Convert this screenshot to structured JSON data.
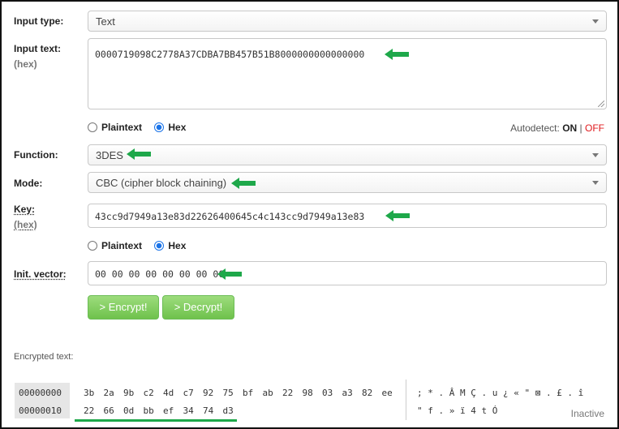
{
  "input_type": {
    "label": "Input type:",
    "value": "Text"
  },
  "input_text": {
    "label": "Input text:",
    "sub": "(hex)",
    "value": "0000719098C2778A37CDBA7BB457B51B8000000000000000"
  },
  "input_format": {
    "plaintext": "Plaintext",
    "hex": "Hex",
    "selected": "Hex"
  },
  "autodetect": {
    "label": "Autodetect:",
    "on": "ON",
    "sep": "|",
    "off": "OFF"
  },
  "function": {
    "label": "Function:",
    "value": "3DES"
  },
  "mode": {
    "label": "Mode:",
    "value": "CBC (cipher block chaining)"
  },
  "key": {
    "label": "Key:",
    "sub": "(hex)",
    "value": "43cc9d7949a13e83d22626400645c4c143cc9d7949a13e83"
  },
  "key_format": {
    "plaintext": "Plaintext",
    "hex": "Hex",
    "selected": "Hex"
  },
  "iv": {
    "label": "Init. vector:",
    "value": "00 00 00 00 00 00 00 00"
  },
  "buttons": {
    "encrypt": "> Encrypt!",
    "decrypt": "> Decrypt!"
  },
  "output": {
    "label": "Encrypted text:",
    "rows": [
      {
        "offset": "00000000",
        "bytes": [
          "3b",
          "2a",
          "9b",
          "c2",
          "4d",
          "c7",
          "92",
          "75",
          "bf",
          "ab",
          "22",
          "98",
          "03",
          "a3",
          "82",
          "ee"
        ],
        "ascii": "; * . Â M Ç . u ¿ « \" ⊠ . £ . î"
      },
      {
        "offset": "00000010",
        "bytes": [
          "22",
          "66",
          "0d",
          "bb",
          "ef",
          "34",
          "74",
          "d3"
        ],
        "ascii": "\" f . » ï 4 t Ó"
      }
    ],
    "status": "Inactive"
  },
  "colors": {
    "accent_arrow": "#1ea84a",
    "button": "#7fcc5c",
    "off": "#e0191c",
    "radio": "#1a73e8"
  }
}
